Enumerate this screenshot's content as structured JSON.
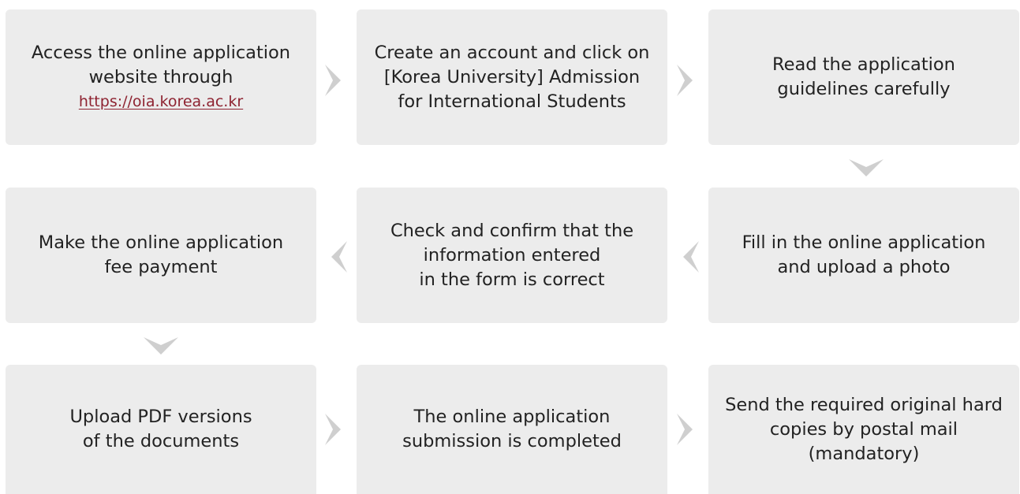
{
  "steps": [
    {
      "lines": [
        "Access the online application",
        "website through"
      ],
      "link": "https://oia.korea.ac.kr"
    },
    {
      "lines": [
        "Create an account and click on",
        "[Korea University] Admission",
        "for International Students"
      ]
    },
    {
      "lines": [
        "Read the application",
        "guidelines carefully"
      ]
    },
    {
      "lines": [
        "Fill in the online application",
        "and upload a photo"
      ]
    },
    {
      "lines": [
        "Check and confirm that the",
        "information entered",
        "in the form is correct"
      ]
    },
    {
      "lines": [
        "Make the online application",
        "fee payment"
      ]
    },
    {
      "lines": [
        "Upload PDF versions",
        "of the documents"
      ]
    },
    {
      "lines": [
        "The online application",
        "submission is completed"
      ]
    },
    {
      "lines": [
        "Send the required original hard",
        "copies by postal mail",
        "(mandatory)"
      ]
    }
  ],
  "colors": {
    "box_background": "#ececec",
    "arrow": "#cfcfcf",
    "link": "#8e2331",
    "text": "#222222"
  },
  "icons": {
    "right": "chevron-right-icon",
    "left": "chevron-left-icon",
    "down": "chevron-down-icon"
  }
}
